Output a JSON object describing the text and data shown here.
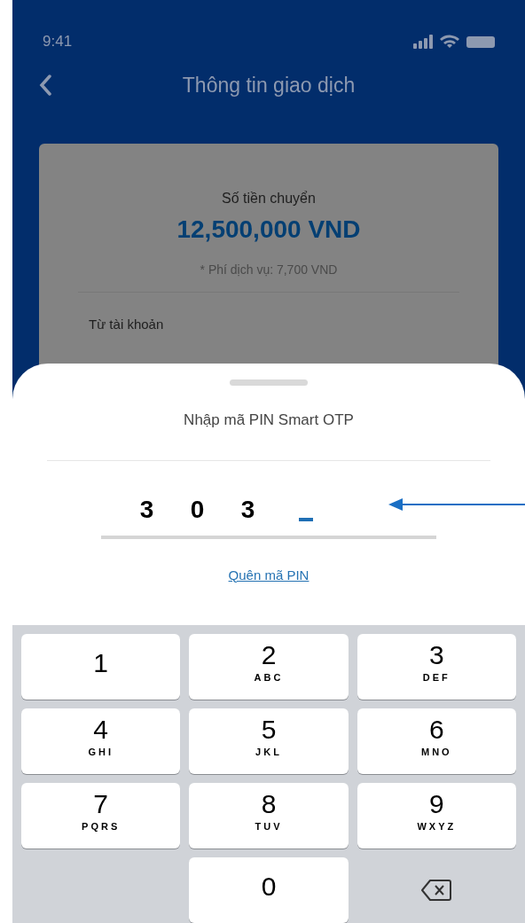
{
  "status_bar": {
    "time": "9:41"
  },
  "header": {
    "title": "Thông tin giao dịch"
  },
  "card": {
    "amount_label": "Số tiền chuyển",
    "amount": "12,500,000 VND",
    "fee": "* Phí dịch vụ: 7,700 VND",
    "from_label": "Từ tài khoản"
  },
  "sheet": {
    "title": "Nhập mã PIN Smart OTP",
    "digits": [
      "3",
      "0",
      "3"
    ],
    "forgot_link": "Quên mã PIN"
  },
  "keypad": [
    {
      "kind": "digit",
      "digit": "1"
    },
    {
      "kind": "digit",
      "digit": "2",
      "letters": "ABC"
    },
    {
      "kind": "digit",
      "digit": "3",
      "letters": "DEF"
    },
    {
      "kind": "digit",
      "digit": "4",
      "letters": "GHI"
    },
    {
      "kind": "digit",
      "digit": "5",
      "letters": "JKL"
    },
    {
      "kind": "digit",
      "digit": "6",
      "letters": "MNO"
    },
    {
      "kind": "digit",
      "digit": "7",
      "letters": "PQRS"
    },
    {
      "kind": "digit",
      "digit": "8",
      "letters": "TUV"
    },
    {
      "kind": "digit",
      "digit": "9",
      "letters": "WXYZ"
    },
    {
      "kind": "blank"
    },
    {
      "kind": "digit",
      "digit": "0"
    },
    {
      "kind": "backspace"
    }
  ]
}
